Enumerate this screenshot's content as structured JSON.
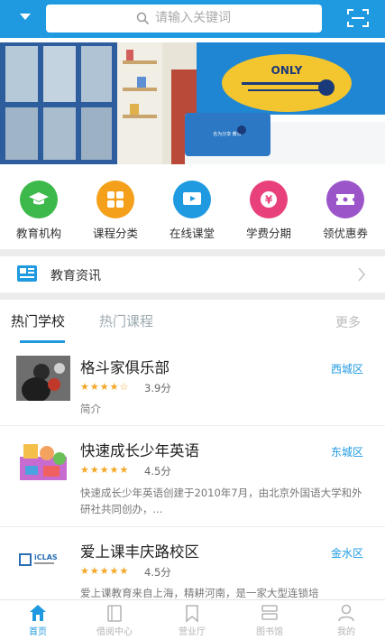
{
  "header": {
    "search_placeholder": "请输入关键词",
    "dropdown_icon": "caret-down-icon",
    "scan_icon": "scan-icon"
  },
  "banner": {
    "sign_text": "ONLY",
    "desk_text": "名为分享 教育"
  },
  "quick_menu": [
    {
      "label": "教育机构",
      "icon": "graduation-cap-icon",
      "color": "#3db84a"
    },
    {
      "label": "课程分类",
      "icon": "grid-icon",
      "color": "#f5a01a"
    },
    {
      "label": "在线课堂",
      "icon": "play-icon",
      "color": "#1f9ae0"
    },
    {
      "label": "学费分期",
      "icon": "yen-icon",
      "color": "#e8407a"
    },
    {
      "label": "领优惠券",
      "icon": "ticket-icon",
      "color": "#9b55c9"
    }
  ],
  "news": {
    "label": "教育资讯"
  },
  "tabs": {
    "active": "热门学校",
    "inactive": "热门课程",
    "more": "更多"
  },
  "schools": [
    {
      "name": "格斗家俱乐部",
      "rating": 3.9,
      "stars_text": "★★★★☆",
      "score": "3.9分",
      "desc": "简介",
      "district": "西城区"
    },
    {
      "name": "快速成长少年英语",
      "rating": 4.5,
      "stars_text": "★★★★★",
      "score": "4.5分",
      "desc": "快速成长少年英语创建于2010年7月，由北京外国语大学和外研社共同创办，...",
      "district": "东城区"
    },
    {
      "name": "爱上课丰庆路校区",
      "rating": 4.5,
      "stars_text": "★★★★★",
      "score": "4.5分",
      "desc": "爱上课教育来自上海，精耕河南，是一家大型连锁培",
      "district": "金水区"
    }
  ],
  "bottom_nav": [
    {
      "label": "首页",
      "icon": "home-icon",
      "active": true
    },
    {
      "label": "借阅中心",
      "icon": "book-icon",
      "active": false
    },
    {
      "label": "营业厅",
      "icon": "bookmark-icon",
      "active": false
    },
    {
      "label": "图书馆",
      "icon": "library-icon",
      "active": false
    },
    {
      "label": "我的",
      "icon": "user-icon",
      "active": false
    }
  ],
  "colors": {
    "accent": "#1f9ae0",
    "star": "#f5a623"
  }
}
